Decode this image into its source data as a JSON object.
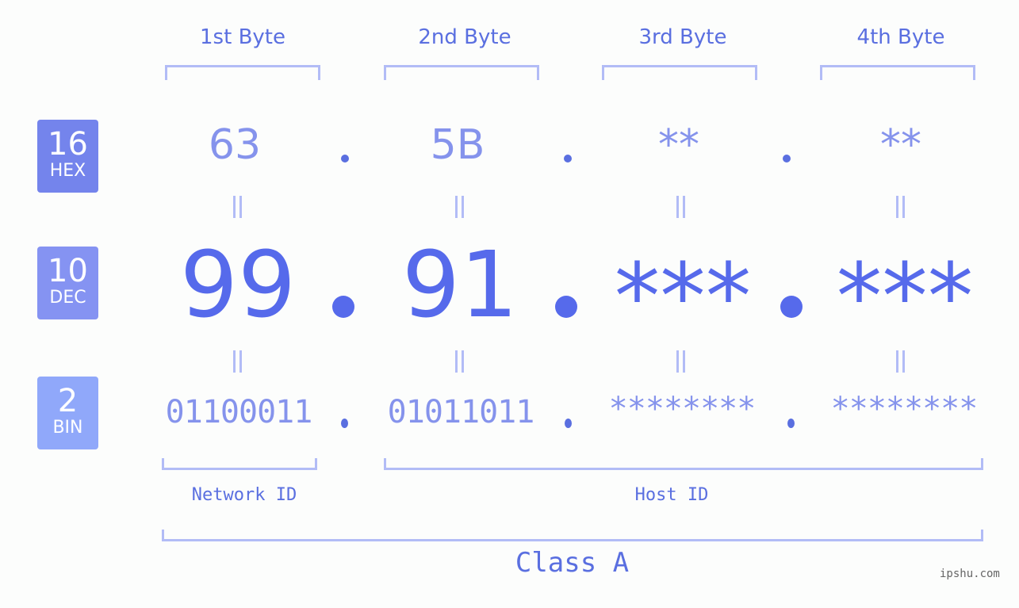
{
  "bases": [
    {
      "number": "16",
      "label": "HEX",
      "color": "#7484ec"
    },
    {
      "number": "10",
      "label": "DEC",
      "color": "#8593f2"
    },
    {
      "number": "2",
      "label": "BIN",
      "color": "#90a8fa"
    }
  ],
  "byte_headers": [
    "1st Byte",
    "2nd Byte",
    "3rd Byte",
    "4th Byte"
  ],
  "hex": [
    "63",
    "5B",
    "**",
    "**"
  ],
  "dec": [
    "99",
    "91",
    "***",
    "***"
  ],
  "bin": [
    "01100011",
    "01011011",
    "********",
    "********"
  ],
  "separator": ".",
  "equals_symbol": "=",
  "parts": {
    "network": "Network ID",
    "host": "Host ID"
  },
  "class_label": "Class A",
  "watermark": "ipshu.com",
  "colors": {
    "accent": "#566aeb",
    "light": "#8593ec",
    "bracket": "#b2bcf6"
  }
}
